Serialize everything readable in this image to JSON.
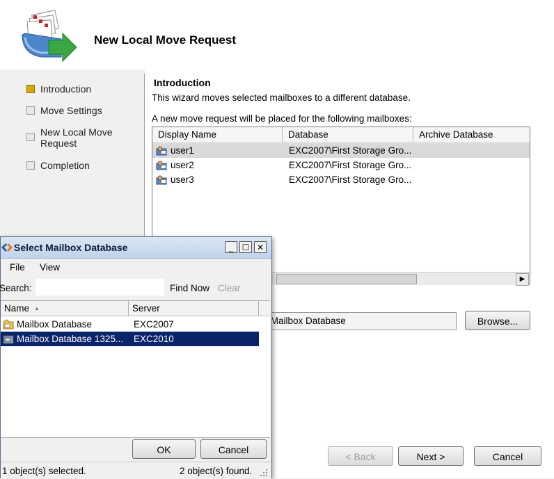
{
  "wizard": {
    "title": "New Local Move Request",
    "steps": [
      {
        "label": "Introduction",
        "active": true
      },
      {
        "label": "Move Settings",
        "active": false
      },
      {
        "label": "New Local Move\nRequest",
        "active": false
      },
      {
        "label": "Completion",
        "active": false
      }
    ],
    "intro": {
      "heading": "Introduction",
      "description": "This wizard moves selected mailboxes to a different database.",
      "prompt": "A new move request will be placed for the following mailboxes:"
    },
    "mailbox_table": {
      "columns": [
        "Display Name",
        "Database",
        "Archive Database"
      ],
      "rows": [
        {
          "name": "user1",
          "database": "EXC2007\\First Storage Gro...",
          "archive": "",
          "selected": true
        },
        {
          "name": "user2",
          "database": "EXC2007\\First Storage Gro...",
          "archive": "",
          "selected": false
        },
        {
          "name": "user3",
          "database": "EXC2007\\First Storage Gro...",
          "archive": "",
          "selected": false
        }
      ]
    },
    "target_database_value": "\\Mailbox Database",
    "browse_label": "Browse...",
    "buttons": {
      "back": "< Back",
      "next": "Next >",
      "cancel": "Cancel"
    }
  },
  "dialog": {
    "title": "Select Mailbox Database",
    "title_buttons": {
      "minimize": "_",
      "maximize": "☐",
      "close": "✕"
    },
    "menu": {
      "file": "File",
      "view": "View"
    },
    "search": {
      "label": "Search:",
      "value": "",
      "find_now": "Find Now",
      "clear": "Clear"
    },
    "columns": {
      "name": "Name",
      "sort_indicator": "▲",
      "server": "Server"
    },
    "rows": [
      {
        "name": "Mailbox Database",
        "server": "EXC2007",
        "selected": false
      },
      {
        "name": "Mailbox Database 1325...",
        "server": "EXC2010",
        "selected": true
      }
    ],
    "ok_label": "OK",
    "cancel_label": "Cancel",
    "status_selected": "1 object(s) selected.",
    "status_found": "2 object(s) found."
  },
  "colors": {
    "selection": "#0a246a",
    "active_step": "#d8a800",
    "dialog_title_bg": "#c1d3ea"
  }
}
